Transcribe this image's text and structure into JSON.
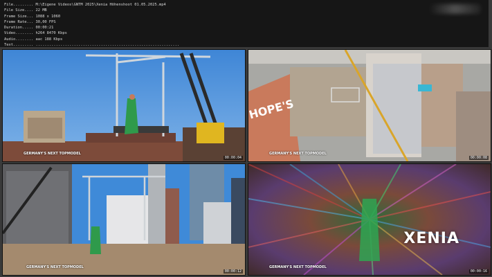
{
  "file_info": [
    {
      "label": "File.........",
      "value": "M:\\Eigene Videos\\GNTM 2025\\Xenia Höhenshoot 01.05.2025.mp4"
    },
    {
      "label": "File Size....",
      "value": "22 MB"
    },
    {
      "label": "Frame Size...",
      "value": "1088 x 1060"
    },
    {
      "label": "Frame Rate...",
      "value": "30,00 FPS"
    },
    {
      "label": "Duration.....",
      "value": "00:00:21"
    },
    {
      "label": "Video........",
      "value": "h264 8470 Kbps"
    },
    {
      "label": "Audio........",
      "value": "aac 188 Kbps"
    },
    {
      "label": "Text.........",
      "value": "................................................................"
    }
  ],
  "thumbnails": [
    {
      "timestamp": "00:00:04",
      "logo": "GERMANY'S NEXT TOPMODEL"
    },
    {
      "timestamp": "00:00:08",
      "logo": "GERMANY'S NEXT TOPMODEL"
    },
    {
      "timestamp": "00:00:12",
      "logo": "GERMANY'S NEXT TOPMODEL"
    },
    {
      "timestamp": "00:00:16",
      "logo": "GERMANY'S NEXT TOPMODEL",
      "title": "XENIA"
    }
  ],
  "colors": {
    "panel_bg": "#161616",
    "panel_text": "#d8d8d8",
    "sky": "#4b8fd8"
  }
}
